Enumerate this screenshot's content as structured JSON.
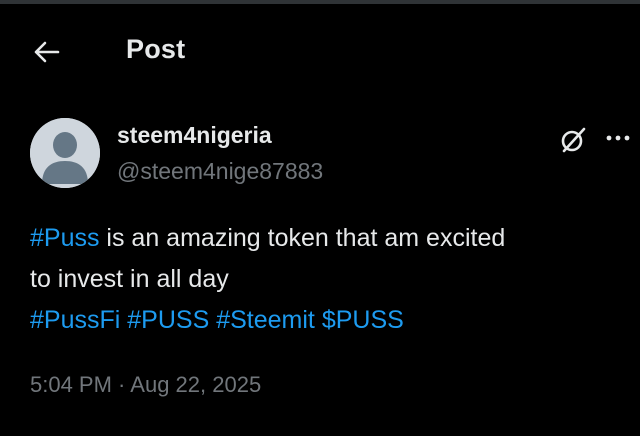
{
  "header": {
    "title": "Post",
    "back_icon": "arrow-left-icon"
  },
  "post": {
    "author": {
      "display_name": "steem4nigeria",
      "handle": "@steem4nige87883",
      "avatar_icon": "default-avatar-icon"
    },
    "actions": {
      "grok_icon": "grok-icon",
      "more_icon": "more-horizontal-icon"
    },
    "text": {
      "line1_tag": "#Puss",
      "line1_rest": " is an amazing token that am excited",
      "line2": "to invest in all day",
      "tags": [
        "#PussFi",
        "#PUSS",
        "#Steemit",
        "$PUSS"
      ]
    },
    "time": "5:04 PM",
    "separator": " · ",
    "date": "Aug 22, 2025"
  },
  "colors": {
    "background": "#000000",
    "text": "#e7e9ea",
    "muted": "#71767b",
    "link": "#1d9bf0"
  }
}
